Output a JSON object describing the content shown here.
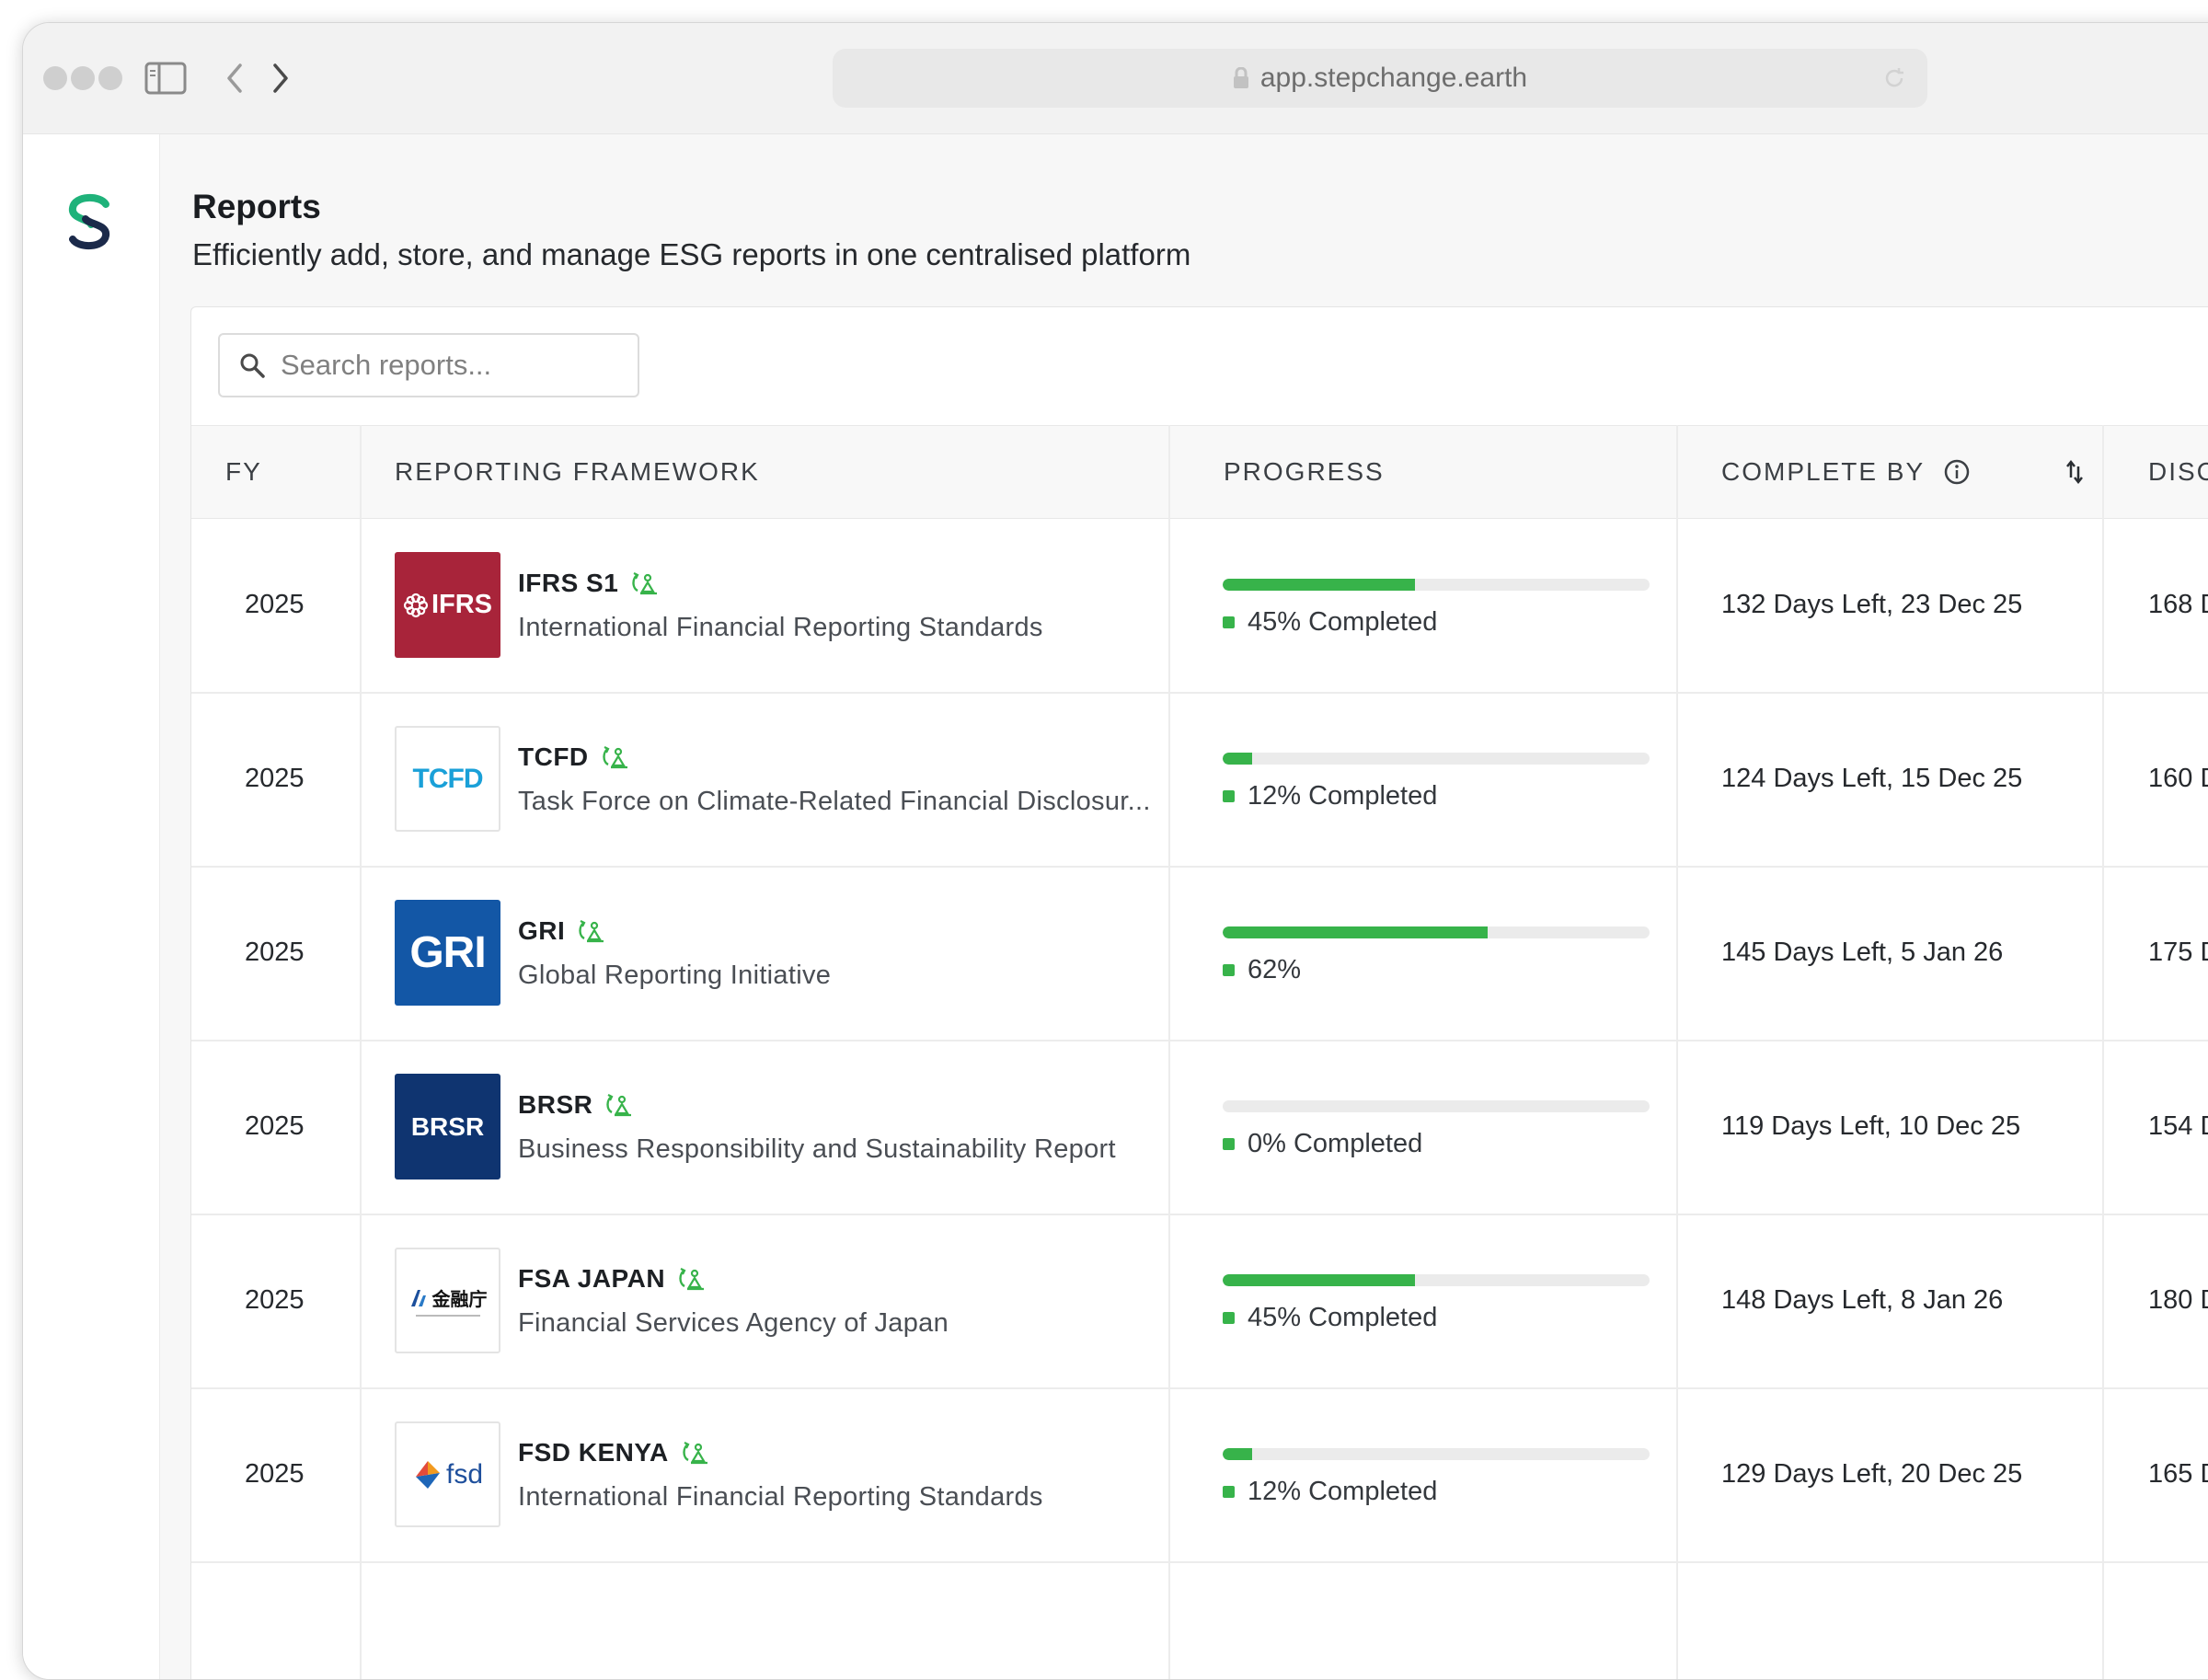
{
  "browser": {
    "url": "app.stepchange.earth"
  },
  "page": {
    "title": "Reports",
    "subtitle": "Efficiently add, store, and manage ESG reports in one centralised platform"
  },
  "search": {
    "placeholder": "Search reports..."
  },
  "table": {
    "headers": {
      "fy": "FY",
      "framework": "REPORTING FRAMEWORK",
      "progress": "PROGRESS",
      "complete_by": "COMPLETE BY",
      "disclosure": "DISC"
    },
    "rows": [
      {
        "fy": "2025",
        "logo_text": "IFRS",
        "logo_icon": "ifrs-logo",
        "name": "IFRS S1",
        "description": "International Financial Reporting Standards",
        "progress_fraction": 0.45,
        "progress_label": "45% Completed",
        "complete_by": "132 Days Left, 23 Dec 25",
        "disclosure": "168 D"
      },
      {
        "fy": "2025",
        "logo_text": "TCFD",
        "logo_icon": "tcfd-logo",
        "name": "TCFD",
        "description": "Task Force on Climate-Related Financial Disclosur...",
        "progress_fraction": 0.07,
        "progress_label": "12% Completed",
        "complete_by": "124 Days Left, 15 Dec 25",
        "disclosure": "160 D"
      },
      {
        "fy": "2025",
        "logo_text": "GRI",
        "logo_icon": "gri-logo",
        "name": "GRI",
        "description": "Global Reporting Initiative",
        "progress_fraction": 0.62,
        "progress_label": "62%",
        "complete_by": "145 Days Left, 5 Jan 26",
        "disclosure": "175 D"
      },
      {
        "fy": "2025",
        "logo_text": "BRSR",
        "logo_icon": "brsr-logo",
        "name": "BRSR",
        "description": "Business Responsibility and Sustainability Report",
        "progress_fraction": 0.0,
        "progress_label": "0% Completed",
        "complete_by": "119 Days Left, 10 Dec 25",
        "disclosure": "154 D"
      },
      {
        "fy": "2025",
        "logo_text": "金融庁",
        "logo_icon": "fsa-japan-logo",
        "name": "FSA JAPAN",
        "description": "Financial Services Agency of Japan",
        "progress_fraction": 0.45,
        "progress_label": "45% Completed",
        "complete_by": "148 Days Left, 8 Jan 26",
        "disclosure": "180 D"
      },
      {
        "fy": "2025",
        "logo_text": "fsd",
        "logo_icon": "fsd-kenya-logo",
        "name": "FSD KENYA",
        "description": "International Financial Reporting Standards",
        "progress_fraction": 0.07,
        "progress_label": "12% Completed",
        "complete_by": "129 Days Left, 20 Dec 25",
        "disclosure": "165 D"
      }
    ]
  },
  "colors": {
    "accent_green": "#37b34a",
    "ifrs_red": "#a8243a",
    "tcfd_blue": "#1aa0d8",
    "gri_blue": "#1357a6",
    "brsr_navy": "#0f3470"
  }
}
